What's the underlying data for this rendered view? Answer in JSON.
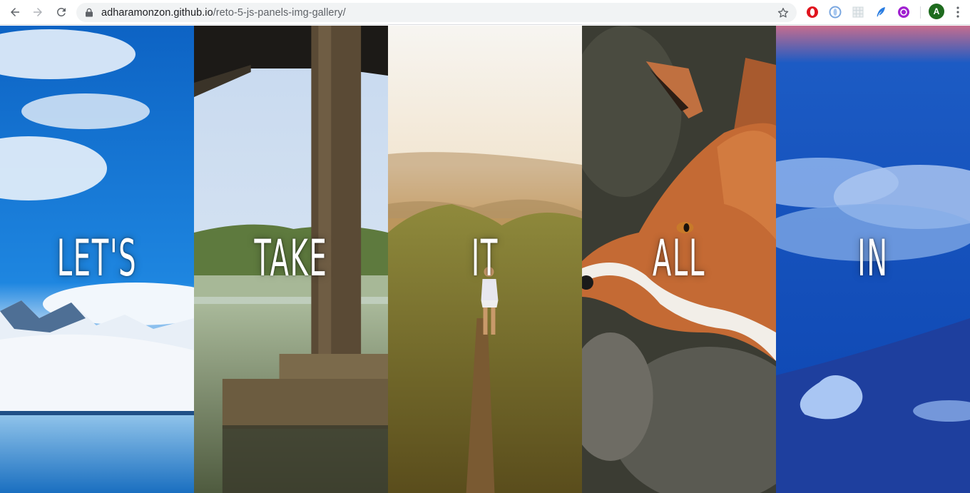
{
  "browser": {
    "url_host": "adharamonzon.github.io",
    "url_path": "/reto-5-js-panels-img-gallery/",
    "avatar_letter": "A",
    "icons": [
      "back-icon",
      "forward-icon",
      "reload-icon",
      "lock-icon",
      "star-icon",
      "opera-icon",
      "extension-icon",
      "grid-extension-icon",
      "feather-icon",
      "purple-extension-icon",
      "menu-icon"
    ]
  },
  "panels": [
    {
      "word": "LET'S",
      "scene": "snowy mountains and lake under blue sky"
    },
    {
      "word": "TAKE",
      "scene": "wooden dock post over misty water"
    },
    {
      "word": "IT",
      "scene": "hiker on grassy ridge at sunrise"
    },
    {
      "word": "ALL",
      "scene": "red fox portrait"
    },
    {
      "word": "IN",
      "scene": "clouds over blue mountain slope"
    }
  ],
  "colors": {
    "chrome_bg": "#ffffff",
    "omnibox_bg": "#f1f3f4",
    "avatar_bg": "#1e6b1e"
  }
}
